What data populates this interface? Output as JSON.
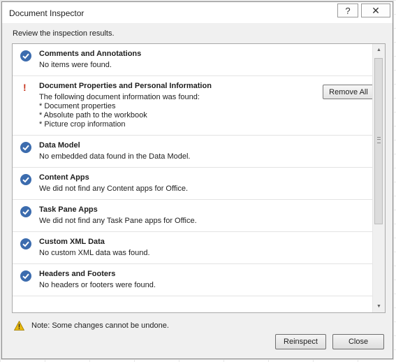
{
  "window": {
    "title": "Document Inspector",
    "help_glyph": "?",
    "close_glyph": "✕"
  },
  "subtitle": "Review the inspection results.",
  "results": [
    {
      "status": "ok",
      "heading": "Comments and Annotations",
      "lines": [
        "No items were found."
      ]
    },
    {
      "status": "found",
      "heading": "Document Properties and Personal Information",
      "lines": [
        "The following document information was found:",
        "* Document properties",
        "* Absolute path to the workbook",
        "* Picture crop information"
      ],
      "action_label": "Remove All"
    },
    {
      "status": "ok",
      "heading": "Data Model",
      "lines": [
        "No embedded data found in the Data Model."
      ]
    },
    {
      "status": "ok",
      "heading": "Content Apps",
      "lines": [
        "We did not find any Content apps for Office."
      ]
    },
    {
      "status": "ok",
      "heading": "Task Pane Apps",
      "lines": [
        "We did not find any Task Pane apps for Office."
      ]
    },
    {
      "status": "ok",
      "heading": "Custom XML Data",
      "lines": [
        "No custom XML data was found."
      ]
    },
    {
      "status": "ok",
      "heading": "Headers and Footers",
      "lines": [
        "No headers or footers were found."
      ]
    }
  ],
  "icons": {
    "ok": "check-circle-icon",
    "found": "exclamation-icon",
    "note": "warning-triangle-icon"
  },
  "colors": {
    "check": "#3c6cae",
    "exclamation": "#c8361f",
    "warning": "#e8b90f"
  },
  "note": "Note: Some changes cannot be undone.",
  "buttons": {
    "reinspect": "Reinspect",
    "close": "Close"
  }
}
